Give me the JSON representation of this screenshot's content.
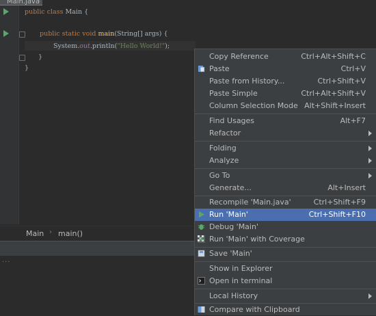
{
  "editor": {
    "tab_title": "Main.java",
    "code": {
      "line1": {
        "kw": "public class",
        "name": "Main",
        "brace": "{"
      },
      "line2": {
        "kw": "public static void",
        "method": "main",
        "params": "(String[] args)",
        "brace": "{"
      },
      "line3": {
        "obj": "System.",
        "field": "out",
        "call": ".println(",
        "str": "\"Hello World!\"",
        "end": ");"
      },
      "line4": "}",
      "line5": "}"
    }
  },
  "breadcrumb": {
    "class": "Main",
    "method": "main()"
  },
  "context_menu": {
    "items": [
      {
        "label": "Copy Reference",
        "shortcut": "Ctrl+Alt+Shift+C"
      },
      {
        "label": "Paste",
        "shortcut": "Ctrl+V",
        "icon": "paste-icon"
      },
      {
        "label": "Paste from History...",
        "shortcut": "Ctrl+Shift+V"
      },
      {
        "label": "Paste Simple",
        "shortcut": "Ctrl+Alt+Shift+V"
      },
      {
        "label": "Column Selection Mode",
        "shortcut": "Alt+Shift+Insert"
      },
      {
        "label": "Find Usages",
        "shortcut": "Alt+F7"
      },
      {
        "label": "Refactor",
        "shortcut": ""
      },
      {
        "label": "Folding",
        "shortcut": ""
      },
      {
        "label": "Analyze",
        "shortcut": ""
      },
      {
        "label": "Go To",
        "shortcut": ""
      },
      {
        "label": "Generate...",
        "shortcut": "Alt+Insert"
      },
      {
        "label": "Recompile 'Main.java'",
        "shortcut": "Ctrl+Shift+F9"
      },
      {
        "label": "Run 'Main'",
        "shortcut": "Ctrl+Shift+F10",
        "icon": "run-icon",
        "selected": true
      },
      {
        "label": "Debug 'Main'",
        "shortcut": "",
        "icon": "debug-icon"
      },
      {
        "label": "Run 'Main' with Coverage",
        "shortcut": "",
        "icon": "coverage-icon"
      },
      {
        "label": "Save 'Main'",
        "shortcut": "",
        "icon": "save-icon"
      },
      {
        "label": "Show in Explorer",
        "shortcut": ""
      },
      {
        "label": "Open in terminal",
        "shortcut": "",
        "icon": "terminal-icon"
      },
      {
        "label": "Local History",
        "shortcut": ""
      },
      {
        "label": "Compare with Clipboard",
        "shortcut": "",
        "icon": "compare-icon"
      }
    ]
  },
  "colors": {
    "selection": "#4b6eaf",
    "menu_bg": "#3c3f41",
    "editor_bg": "#2b2b2b",
    "run_green": "#59a869"
  }
}
